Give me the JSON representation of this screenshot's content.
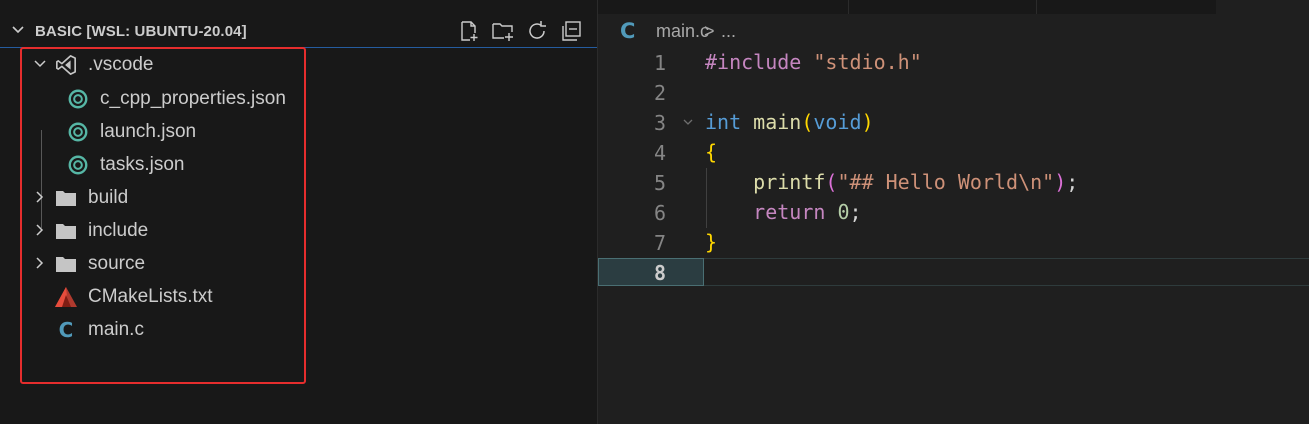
{
  "explorer": {
    "title": "BASIC [WSL: UBUNTU-20.04]",
    "actions": [
      {
        "name": "new-file-icon"
      },
      {
        "name": "new-folder-icon"
      },
      {
        "name": "refresh-icon"
      },
      {
        "name": "collapse-all-icon"
      }
    ],
    "tree": {
      "vscode": ".vscode",
      "c_cpp": "c_cpp_properties.json",
      "launch": "launch.json",
      "tasks": "tasks.json",
      "build": "build",
      "include": "include",
      "source": "source",
      "cmake": "CMakeLists.txt",
      "mainc": "main.c"
    }
  },
  "editor": {
    "breadcrumb": {
      "icon": "C",
      "file": "main.c",
      "separator": ">",
      "more": "..."
    },
    "line_numbers": [
      "1",
      "2",
      "3",
      "4",
      "5",
      "6",
      "7",
      "8"
    ],
    "code": {
      "l1_directive": "#include",
      "l1_path": " \"stdio.h\"",
      "l3_type": "int",
      "l3_name": " main",
      "l3_open": "(",
      "l3_param": "void",
      "l3_close": ")",
      "l4_brace": "{",
      "l5_indent": "    ",
      "l5_fn": "printf",
      "l5_open": "(",
      "l5_str": "\"## Hello World\\n\"",
      "l5_close": ")",
      "l5_semi": ";",
      "l6_indent": "    ",
      "l6_kw": "return",
      "l6_space": " ",
      "l6_num": "0",
      "l6_semi": ";",
      "l7_brace": "}"
    }
  },
  "colors": {
    "highlight_border": "#e52d2d",
    "accent": "#2b79d8",
    "c_icon": "#519aba",
    "json_icon": "#56b6a5",
    "cmake_icon": "#c0392b"
  }
}
